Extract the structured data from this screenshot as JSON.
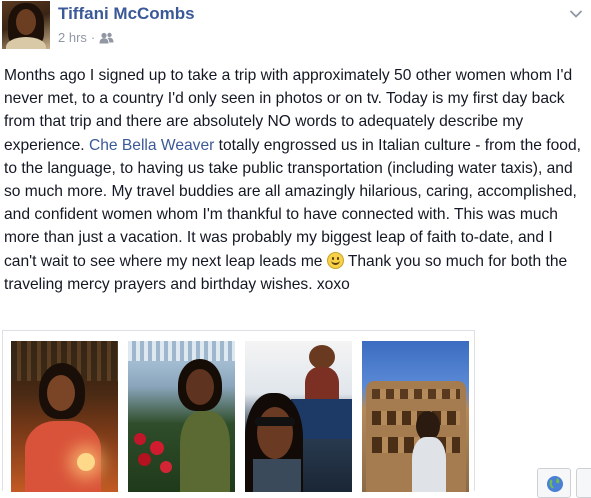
{
  "post": {
    "author": "Tiffani McCombs",
    "timestamp": "2 hrs",
    "audience_icon": "friends-icon",
    "text_before_mention": "Months ago I signed up to take a trip with approximately 50 other women whom I'd never met, to a country I'd only seen in photos or on tv. Today is my first day back from that trip and there are absolutely NO words to adequately describe my experience. ",
    "mention": "Che Bella Weaver",
    "text_after_mention": " totally engrossed us in Italian culture - from the food, to the language, to having us take public transportation (including water taxis), and so much more. My travel buddies are all amazingly hilarious, caring, accomplished, and confident women whom I'm thankful to have connected with. This was much more than just a vacation. It was probably my biggest leap of faith to-date, and I can't wait to see where my next leap leads me ",
    "emoji": "smiley-emoji",
    "text_after_emoji": " Thank you so much for both the traveling mercy prayers and birthday wishes. xoxo"
  },
  "photos": [
    {
      "name": "photo-birthday-dinner"
    },
    {
      "name": "photo-garden-roses"
    },
    {
      "name": "photo-water-taxi"
    },
    {
      "name": "photo-colosseum"
    }
  ],
  "icons": {
    "chevron": "chevron-down-icon",
    "globe": "globe-icon"
  },
  "colors": {
    "link": "#3b5998",
    "text": "#141823",
    "meta": "#9197a3"
  }
}
